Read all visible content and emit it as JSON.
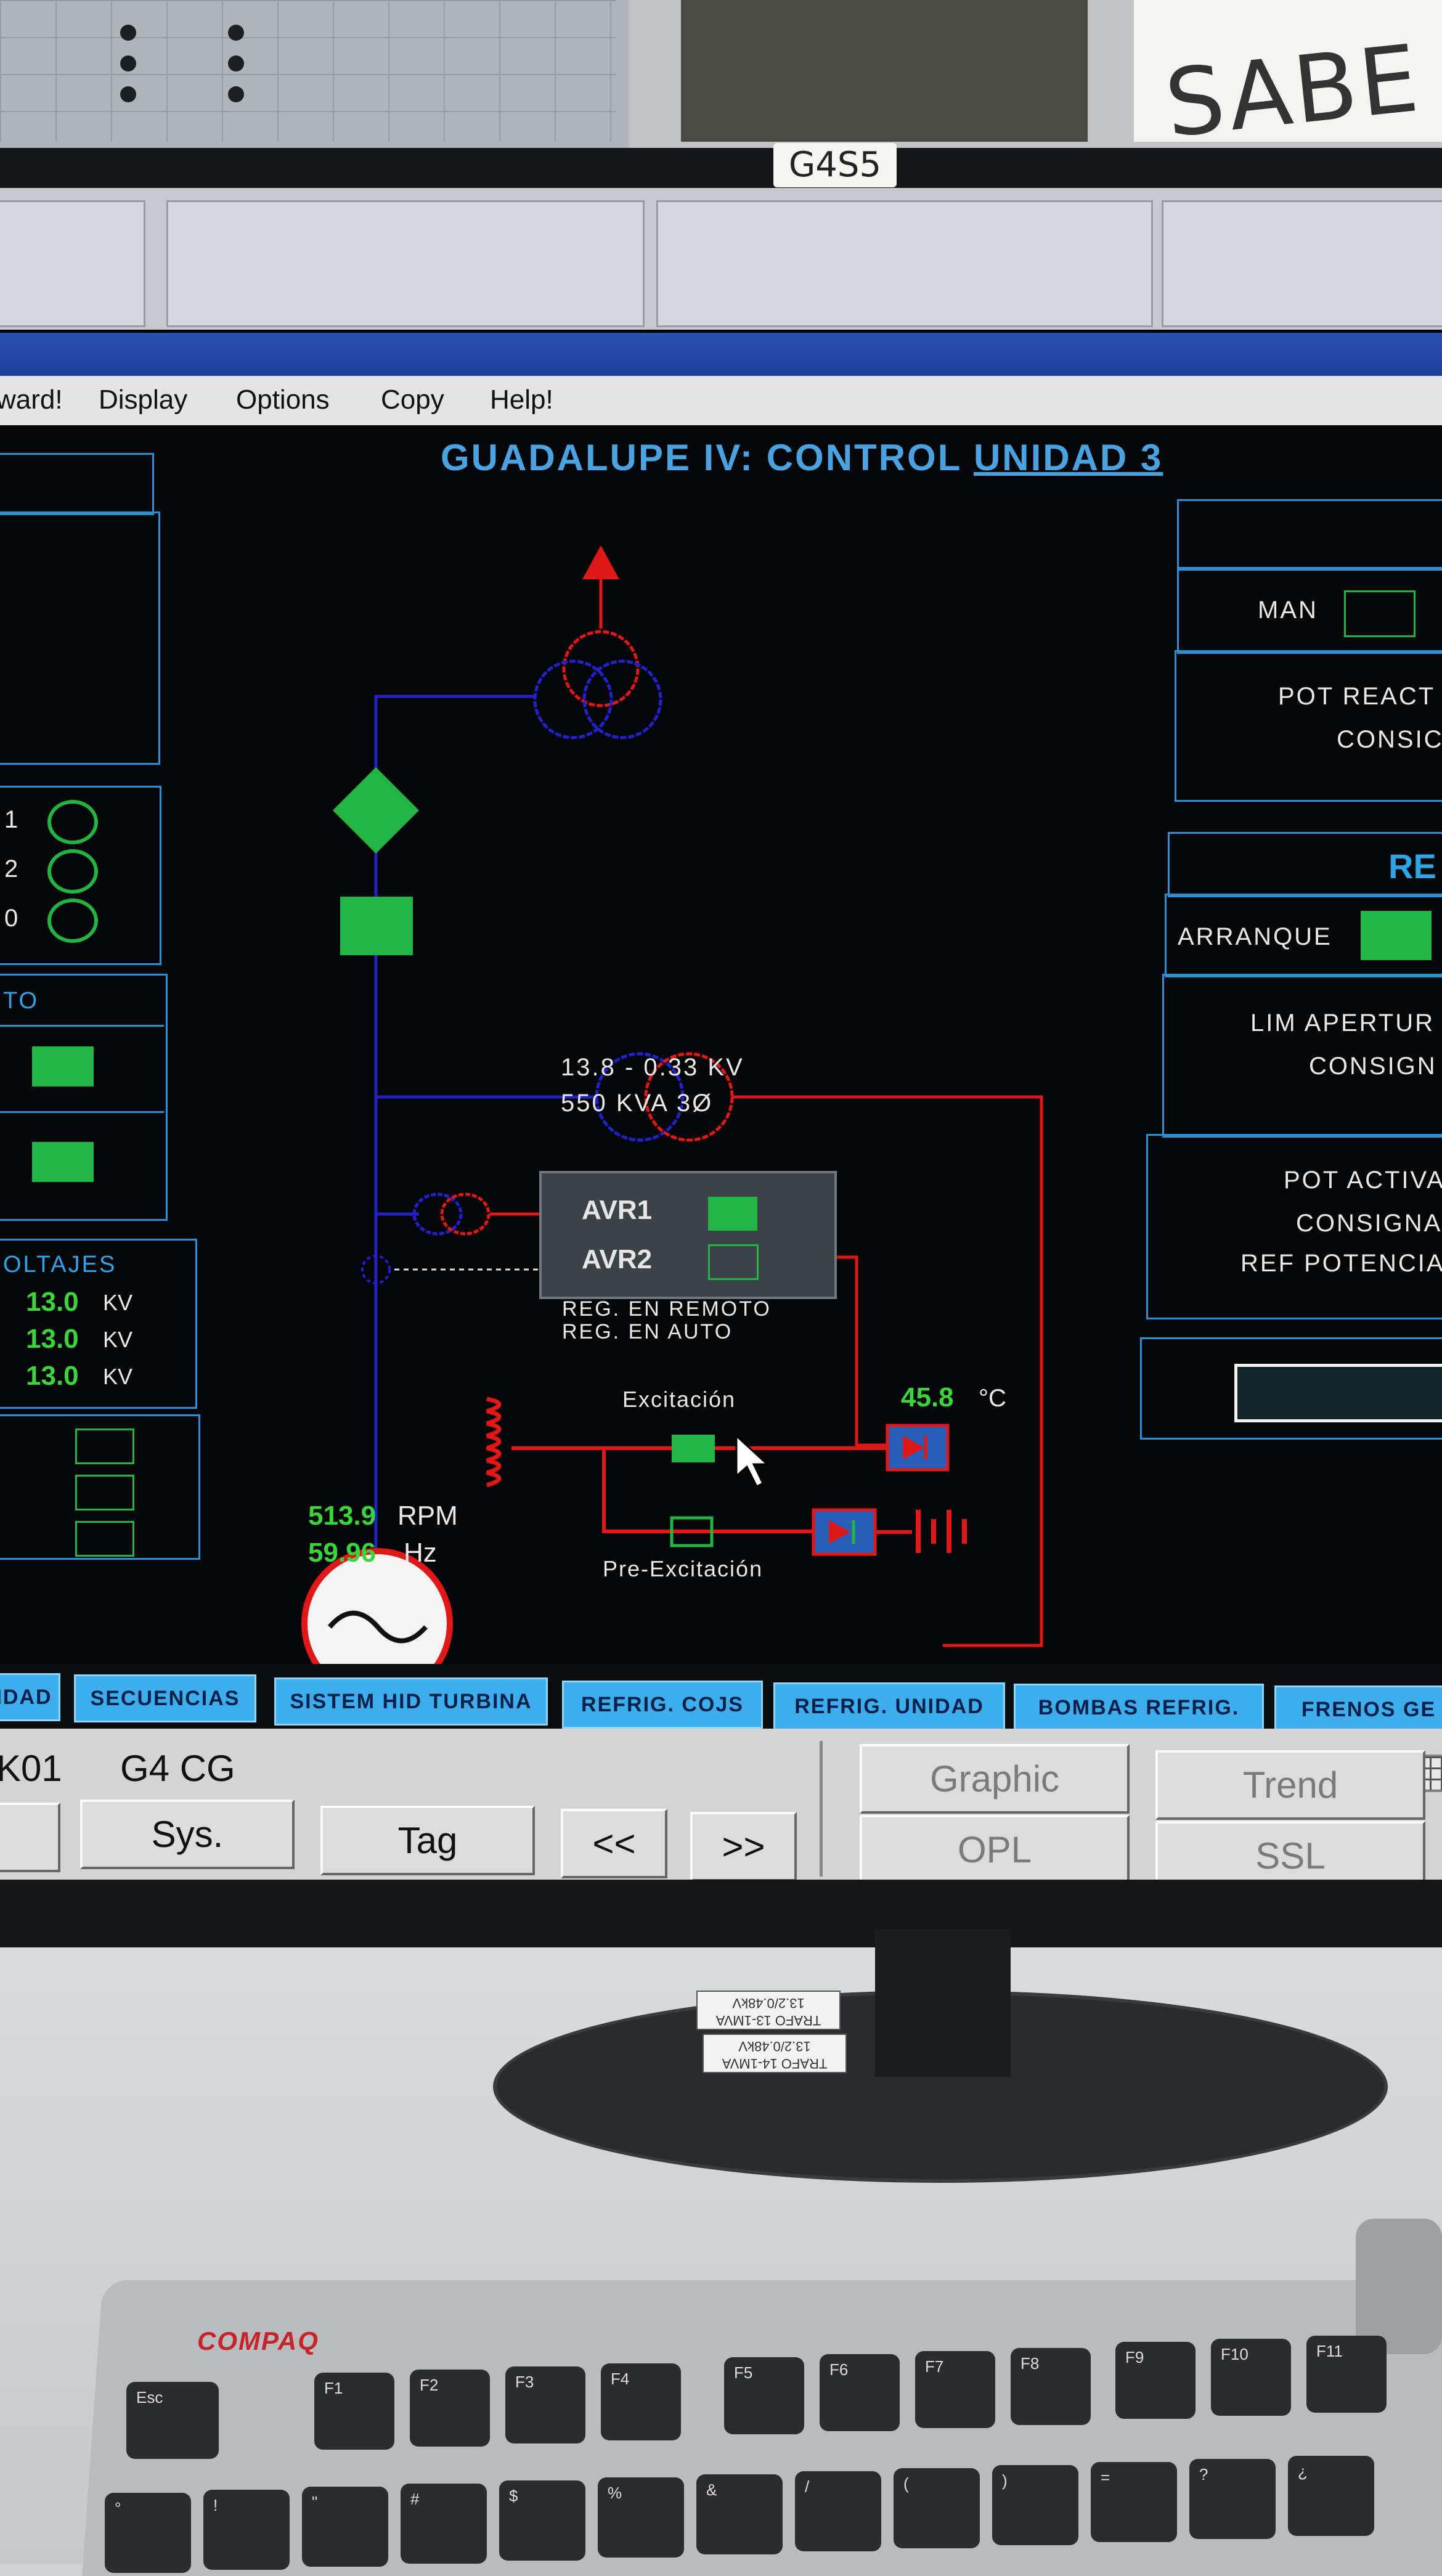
{
  "surroundings": {
    "monitor_label": "G4S5",
    "poster_text": "SABE L"
  },
  "window": {
    "menu": [
      "ward!",
      "Display",
      "Options",
      "Copy",
      "Help!"
    ]
  },
  "hmi": {
    "title_prefix": "GUADALUPE IV: CONTROL ",
    "title_unit": "UNIDAD 3",
    "left": {
      "ring_labels": [
        "1",
        "2",
        "0"
      ],
      "section_to": "TO",
      "voltajes_title": "OLTAJES",
      "voltages": [
        {
          "value": "13.0",
          "unit": "KV"
        },
        {
          "value": "13.0",
          "unit": "KV"
        },
        {
          "value": "13.0",
          "unit": "KV"
        }
      ]
    },
    "diagram": {
      "transformer_ratio": "13.8 - 0.33 KV",
      "transformer_rating": "550 KVA 3Ø",
      "avr1": "AVR1",
      "avr2": "AVR2",
      "reg_remoto": "REG. EN REMOTO",
      "reg_auto": "REG. EN AUTO",
      "excitacion": "Excitación",
      "pre_excitacion": "Pre-Excitación",
      "temperature_value": "45.8",
      "temperature_unit": "°C",
      "rpm_value": "513.9",
      "rpm_unit": "RPM",
      "hz_value": "59.96",
      "hz_unit": "Hz"
    },
    "right": {
      "man_label": "MAN",
      "pot_react": "POT REACT",
      "consig_1": "CONSIC",
      "section_re": "RE",
      "arranque": "ARRANQUE",
      "lim_apertura": "LIM APERTUR",
      "consig_2": "CONSIGN",
      "pot_activa": "POT ACTIVA",
      "consigna": "CONSIGNA",
      "ref_potencia": "REF POTENCIA"
    }
  },
  "tabs": [
    "IDAD",
    "SECUENCIAS",
    "SISTEM HID TURBINA",
    "REFRIG. COJS",
    "REFRIG. UNIDAD",
    "BOMBAS REFRIG.",
    "FRENOS GE"
  ],
  "toolbar": {
    "point_id": "K01",
    "point_name": "G4 CG",
    "buttons": {
      "sys": "Sys.",
      "tag": "Tag",
      "prev": "<<",
      "next": ">>",
      "graphic": "Graphic",
      "trend": "Trend",
      "opl": "OPL",
      "ssl": "SSL"
    }
  },
  "desk": {
    "sticker_1": "TRAFO 13-1MVA 13.2/0.48kV",
    "sticker_2": "TRAFO 14-1MVA 13.2/0.48kV",
    "keyboard_brand": "COMPAQ",
    "keys_fn": [
      "Esc",
      "F1",
      "F2",
      "F3",
      "F4",
      "F5",
      "F6",
      "F7",
      "F8",
      "F9",
      "F10",
      "F11"
    ],
    "keys_num": [
      "°",
      "!",
      "\"",
      "#",
      "$",
      "%",
      "&",
      "/",
      "(",
      ")",
      "=",
      "?",
      "¿"
    ]
  },
  "colors": {
    "hmi_cyan": "#2e8fd0",
    "status_green": "#22b544",
    "line_blue": "#2222cc",
    "line_red": "#e01818",
    "tab_blue": "#3dadeb"
  }
}
